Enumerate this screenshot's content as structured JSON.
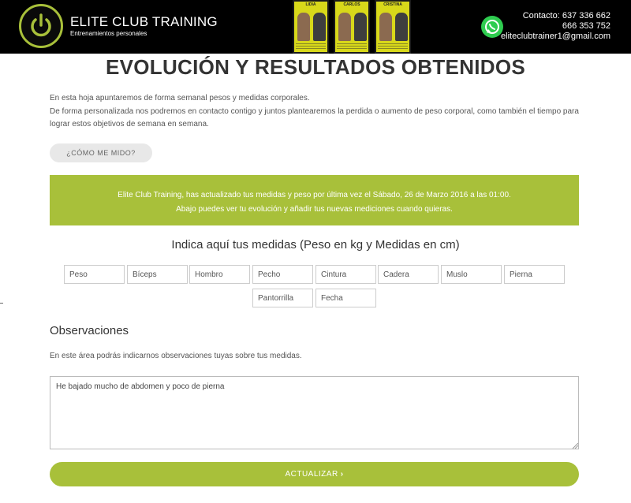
{
  "header": {
    "brand_title": "ELITE CLUB TRAINING",
    "brand_subtitle": "Entrenamientos personales",
    "photos": [
      {
        "label": "LIDIA"
      },
      {
        "label": "CARLOS"
      },
      {
        "label": "CRISTINA"
      }
    ],
    "contact": {
      "line1": "Contacto: 637 336 662",
      "line2": "666 353 752",
      "line3": "eliteclubtrainer1@gmail.com"
    },
    "icons": {
      "logo": "power-icon",
      "whatsapp": "whatsapp-icon"
    }
  },
  "main": {
    "title": "EVOLUCIÓN Y RESULTADOS OBTENIDOS",
    "intro_line1": "En esta hoja apuntaremos de forma semanal pesos y medidas corporales.",
    "intro_line2": "De forma personalizada nos podremos en contacto contigo y juntos plantearemos la perdida o aumento de peso corporal, como también el tiempo para lograr estos objetivos de semana en semana.",
    "measure_button": "¿CÓMO ME MIDO?",
    "banner_line1": "Elite Club Training, has actualizado tus medidas y peso por última vez el Sábado, 26 de Marzo 2016 a las 01:00.",
    "banner_line2": "Abajo puedes ver tu evolución y añadir tus nuevas mediciones cuando quieras.",
    "measures_title": "Indica aquí tus medidas (Peso en kg y Medidas en cm)",
    "fields": [
      "Peso",
      "Bíceps",
      "Hombro",
      "Pecho",
      "Cintura",
      "Cadera",
      "Muslo",
      "Pierna",
      "Pantorrilla",
      "Fecha"
    ],
    "observations_title": "Observaciones",
    "observations_text": "En este área podrás indicarnos observaciones tuyas sobre tus medidas.",
    "observations_value": "He bajado mucho de abdomen y poco de pierna",
    "submit_label": "ACTUALIZAR",
    "submit_chevron": "›"
  },
  "colors": {
    "accent": "#a8c03a",
    "header_bg": "#000000",
    "whatsapp": "#2ecc4f"
  }
}
